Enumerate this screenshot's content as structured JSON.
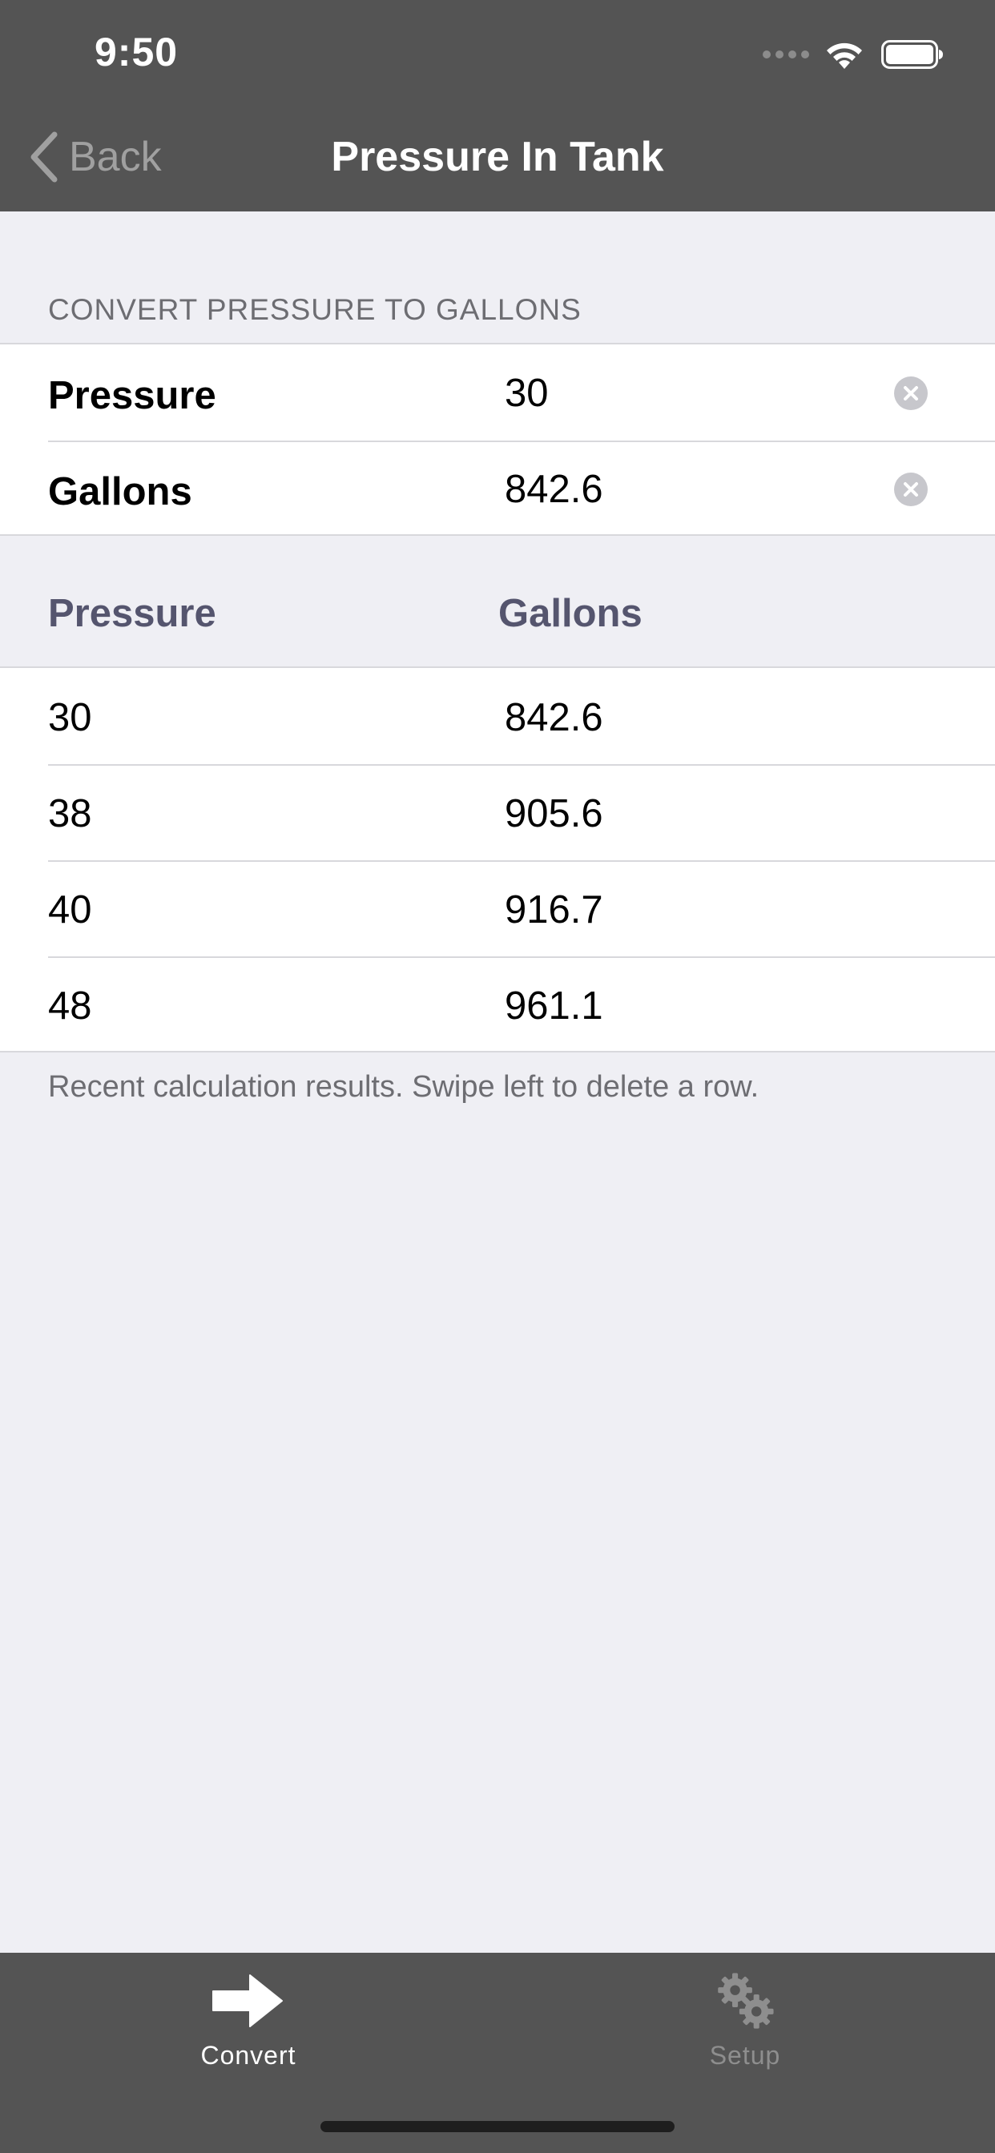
{
  "status_bar": {
    "time": "9:50"
  },
  "nav": {
    "back_label": "Back",
    "title": "Pressure In Tank"
  },
  "convert_section": {
    "header": "CONVERT PRESSURE TO GALLONS",
    "fields": [
      {
        "label": "Pressure",
        "value": "30"
      },
      {
        "label": "Gallons",
        "value": "842.6"
      }
    ]
  },
  "results_table": {
    "columns": [
      "Pressure",
      "Gallons"
    ],
    "rows": [
      {
        "pressure": "30",
        "gallons": "842.6"
      },
      {
        "pressure": "38",
        "gallons": "905.6"
      },
      {
        "pressure": "40",
        "gallons": "916.7"
      },
      {
        "pressure": "48",
        "gallons": "961.1"
      }
    ],
    "footer": "Recent calculation results.  Swipe left to delete a row."
  },
  "tab_bar": {
    "tabs": [
      {
        "label": "Convert",
        "icon": "arrow-right-icon",
        "selected": true
      },
      {
        "label": "Setup",
        "icon": "gears-icon",
        "selected": false
      }
    ]
  },
  "colors": {
    "bar_background": "#545454",
    "page_background": "#efeff4",
    "column_header": "#55556e",
    "muted_text": "#6d6d72"
  }
}
